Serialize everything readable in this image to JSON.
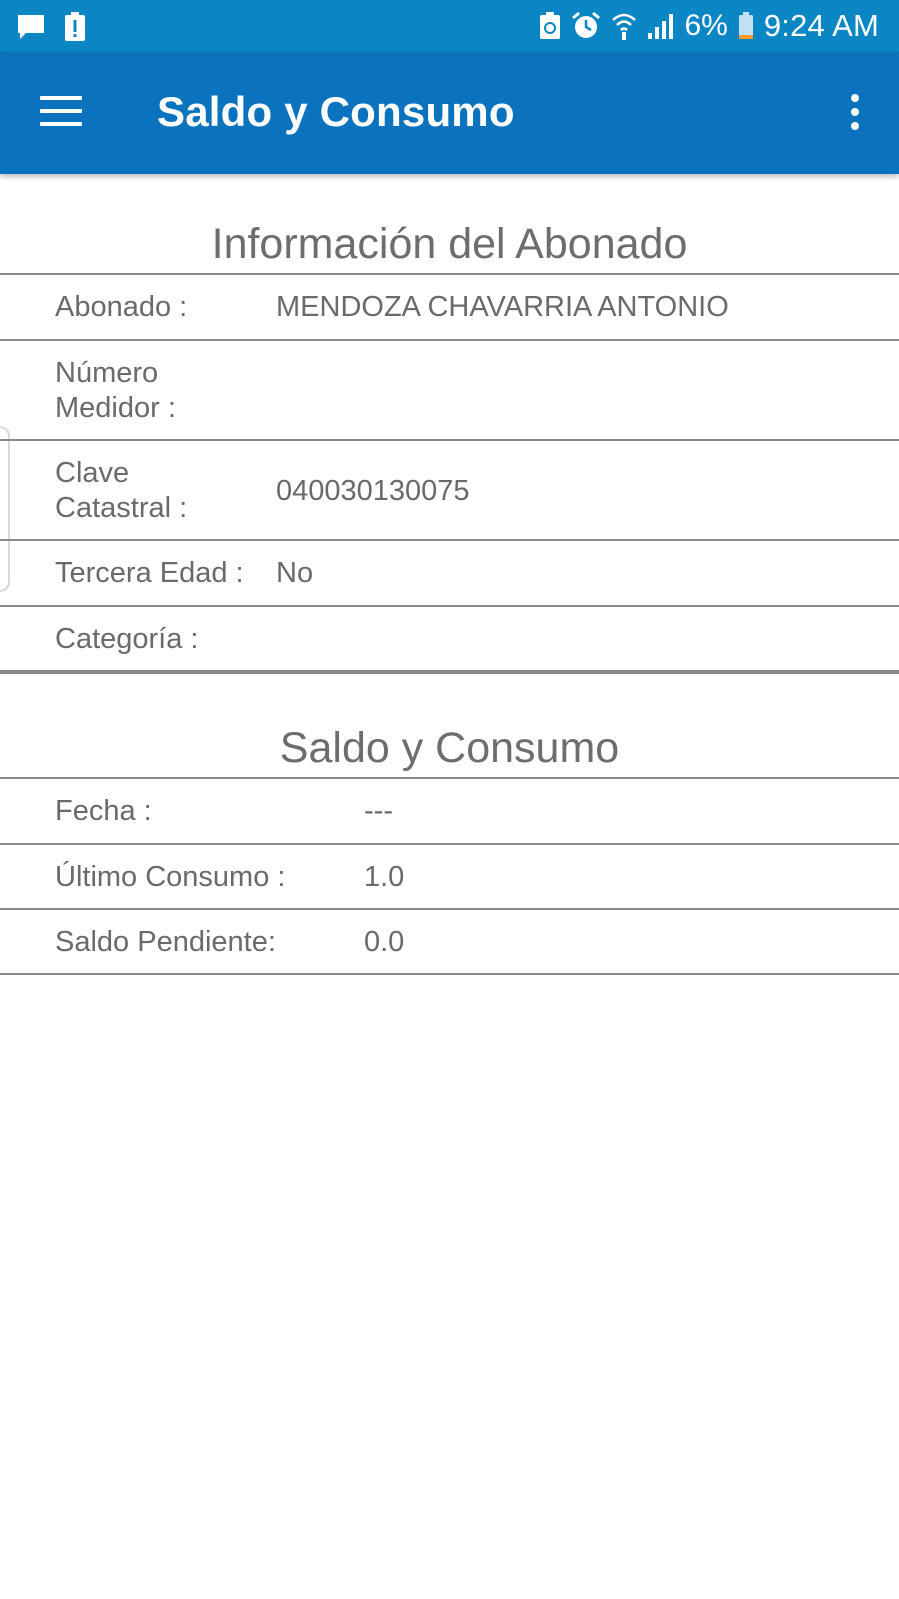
{
  "status_bar": {
    "battery": "6%",
    "time": "9:24 AM"
  },
  "app_bar": {
    "title": "Saldo y Consumo"
  },
  "subscriber_section": {
    "title": "Información del Abonado",
    "rows": [
      {
        "label": "Abonado :",
        "value": "MENDOZA CHAVARRIA ANTONIO"
      },
      {
        "label_line1": "Número",
        "label_line2": "Medidor :",
        "value": ""
      },
      {
        "label_line1": "Clave",
        "label_line2": "Catastral :",
        "value": "040030130075"
      },
      {
        "label": "Tercera Edad :",
        "value": "No"
      },
      {
        "label": "Categoría :",
        "value": ""
      }
    ]
  },
  "balance_section": {
    "title": "Saldo y Consumo",
    "rows": [
      {
        "label": "Fecha :",
        "value": "---"
      },
      {
        "label": "Último Consumo :",
        "value": "1.0"
      },
      {
        "label": "Saldo Pendiente:",
        "value": "0.0"
      }
    ]
  }
}
